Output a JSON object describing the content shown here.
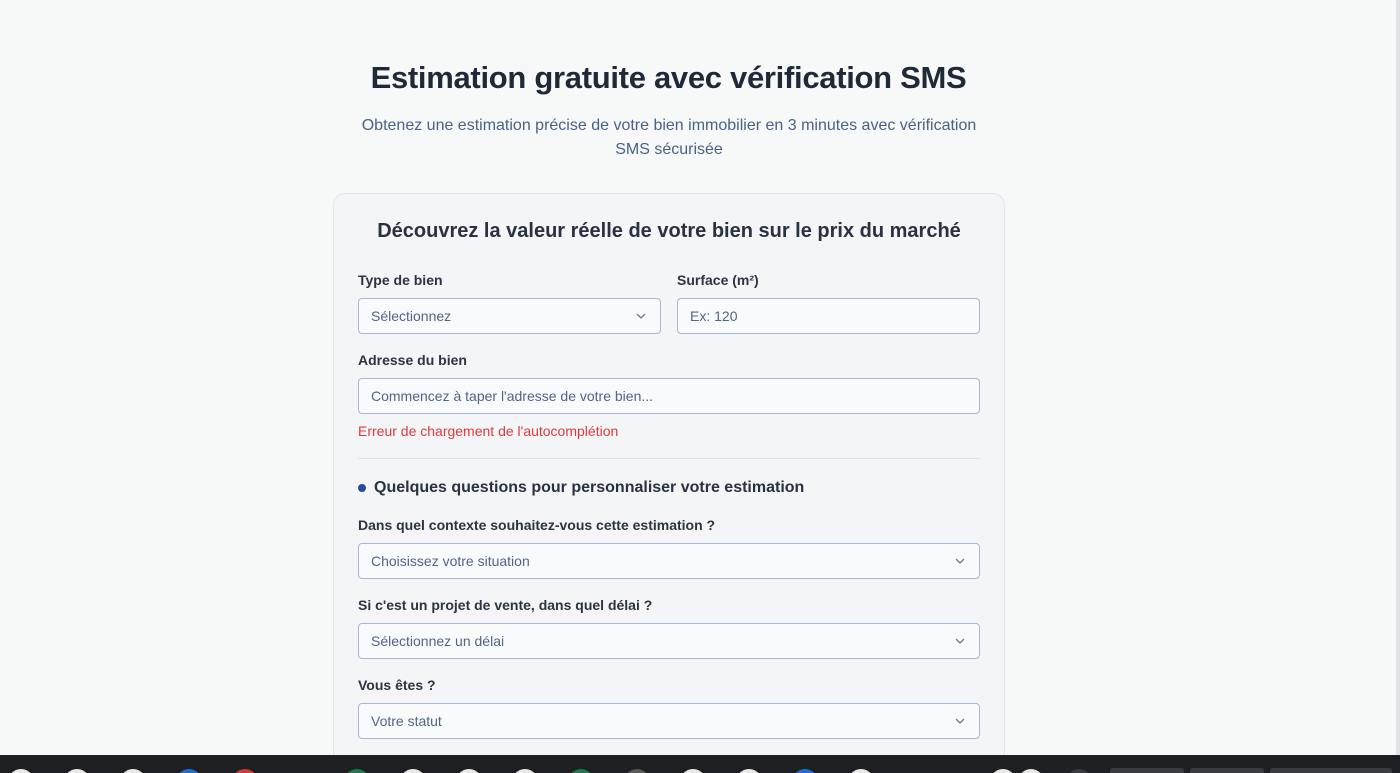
{
  "hero": {
    "title": "Estimation gratuite avec vérification SMS",
    "subtitle_line1": "Obtenez une estimation précise de votre bien immobilier en 3 minutes avec vérification",
    "subtitle_line2": "SMS sécurisée"
  },
  "form": {
    "title": "Découvrez la valeur réelle de votre bien sur le prix du marché",
    "property_type": {
      "label": "Type de bien",
      "value": "Sélectionnez"
    },
    "surface": {
      "label": "Surface (m²)",
      "placeholder": "Ex: 120"
    },
    "address": {
      "label": "Adresse du bien",
      "placeholder": "Commencez à taper l'adresse de votre bien..."
    },
    "error": "Erreur de chargement de l'autocomplétion",
    "section_title": "Quelques questions pour personnaliser votre estimation",
    "context": {
      "label": "Dans quel contexte souhaitez-vous cette estimation ?",
      "value": "Choisissez votre situation"
    },
    "delay": {
      "label": "Si c'est un projet de vente, dans quel délai ?",
      "value": "Sélectionnez un délai"
    },
    "status": {
      "label": "Vous êtes ?",
      "value": "Votre statut"
    }
  },
  "colors": {
    "accent_dot": "#2a4a9b",
    "error": "#e03b3b",
    "field_border": "#a9b6d3"
  }
}
